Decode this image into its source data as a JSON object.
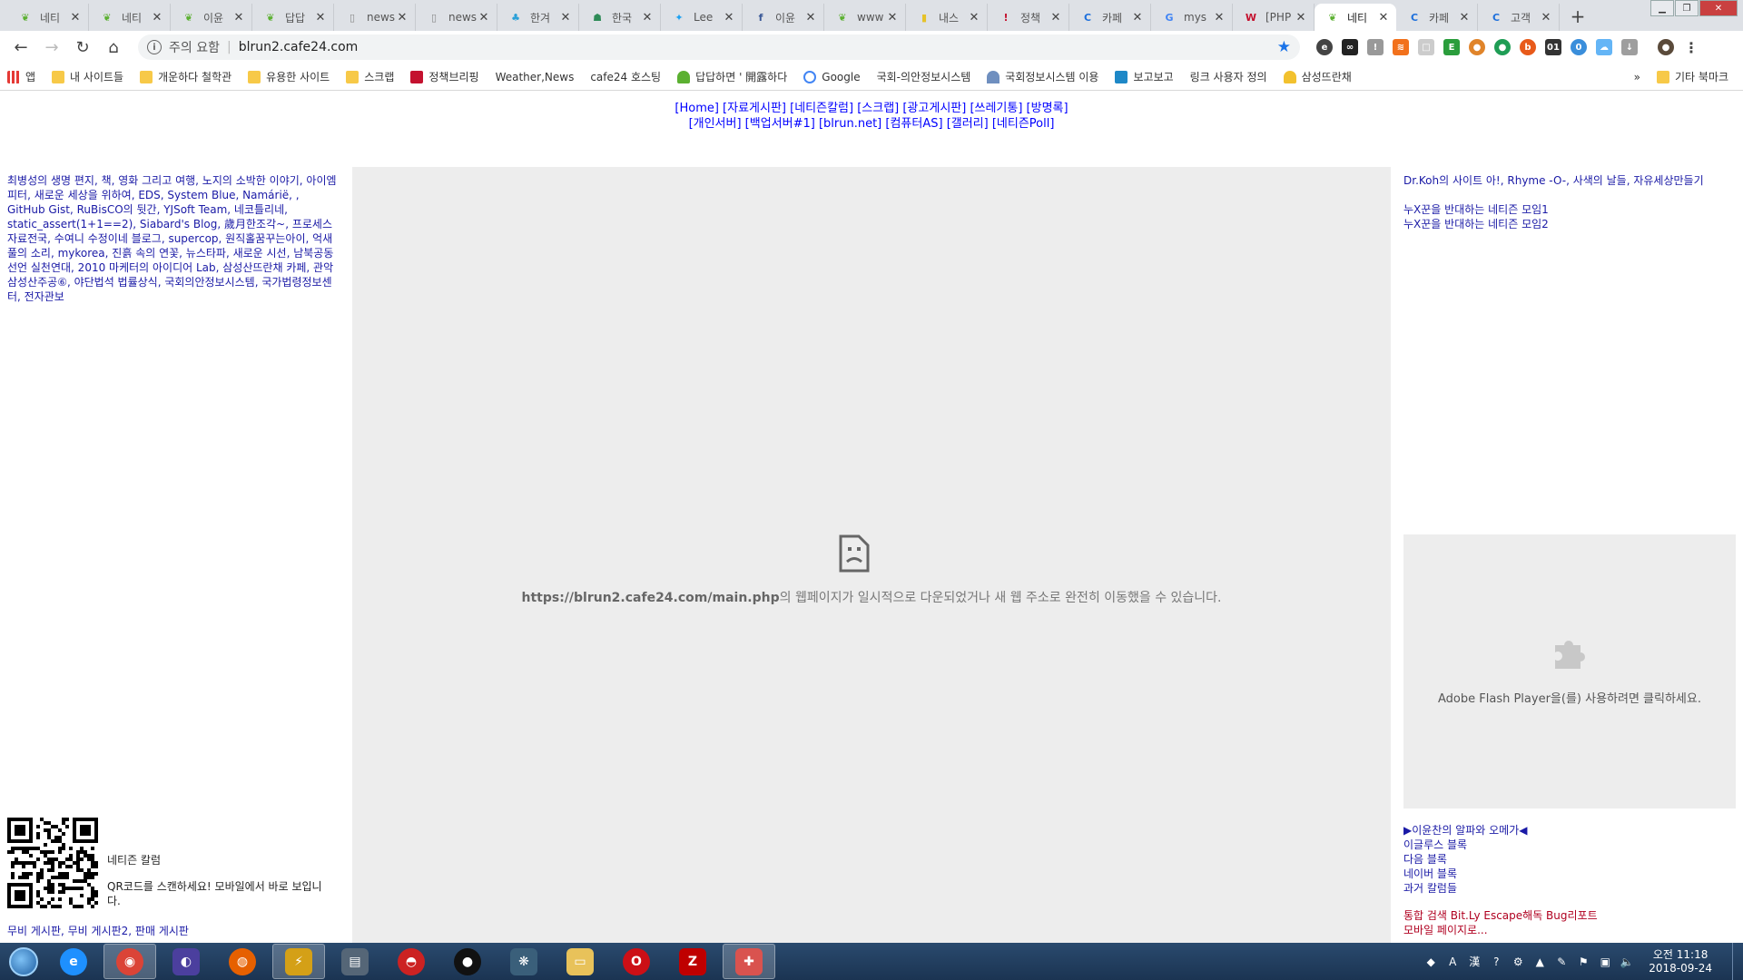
{
  "browser": {
    "tabs": [
      {
        "title": "네티",
        "favicon": "sprout-icon",
        "color": "#5bb031"
      },
      {
        "title": "네티",
        "favicon": "sprout-icon",
        "color": "#5bb031"
      },
      {
        "title": "이윤",
        "favicon": "sprout-icon",
        "color": "#5bb031"
      },
      {
        "title": "답답",
        "favicon": "sprout-icon",
        "color": "#5bb031"
      },
      {
        "title": "news",
        "favicon": "page-icon",
        "color": "#888888"
      },
      {
        "title": "news",
        "favicon": "page-icon",
        "color": "#888888"
      },
      {
        "title": "한겨",
        "favicon": "hani-icon",
        "color": "#2aa0d8"
      },
      {
        "title": "한국",
        "favicon": "person-icon",
        "color": "#2e8b57"
      },
      {
        "title": "Lee",
        "favicon": "twitter-icon",
        "color": "#1da1f2"
      },
      {
        "title": "이윤",
        "favicon": "facebook-icon",
        "color": "#3b5998"
      },
      {
        "title": "www",
        "favicon": "sprout-icon",
        "color": "#5bb031"
      },
      {
        "title": "내스",
        "favicon": "bookmark-icon",
        "color": "#e6c229"
      },
      {
        "title": "정책",
        "favicon": "policy-icon",
        "color": "#c4122f"
      },
      {
        "title": "카페",
        "favicon": "cafe24-icon",
        "color": "#1d6fdc"
      },
      {
        "title": "mys",
        "favicon": "google-icon",
        "color": "#4285f4"
      },
      {
        "title": "[PHP",
        "favicon": "w-icon",
        "color": "#c4122f"
      },
      {
        "title": "네티",
        "favicon": "sprout-icon",
        "color": "#5bb031",
        "active": true
      },
      {
        "title": "카페",
        "favicon": "cafe24-icon",
        "color": "#1d6fdc"
      },
      {
        "title": "고객",
        "favicon": "cafe24-icon",
        "color": "#1d6fdc"
      }
    ],
    "omnibox": {
      "security_label": "주의 요함",
      "url": "blrun2.cafe24.com"
    },
    "bookmarks": [
      {
        "label": "앱",
        "type": "apps"
      },
      {
        "label": "내 사이트들",
        "type": "folder"
      },
      {
        "label": "개운하다 철학관",
        "type": "folder"
      },
      {
        "label": "유용한 사이트",
        "type": "folder"
      },
      {
        "label": "스크랩",
        "type": "folder"
      },
      {
        "label": "정책브리핑",
        "type": "policy"
      },
      {
        "label": "Weather,News",
        "type": "page"
      },
      {
        "label": "cafe24 호스팅",
        "type": "page"
      },
      {
        "label": "답답하면 ' 開露하다",
        "type": "sprout"
      },
      {
        "label": "Google",
        "type": "google"
      },
      {
        "label": "국회-의안정보시스템",
        "type": "page"
      },
      {
        "label": "국회정보시스템 이용",
        "type": "assembly"
      },
      {
        "label": "보고보고",
        "type": "cyan"
      },
      {
        "label": "링크 사용자 정의",
        "type": "page"
      },
      {
        "label": "삼성뜨란채",
        "type": "bell"
      }
    ],
    "bookmarks_overflow": "»",
    "other_bookmarks": "기타 북마크"
  },
  "page": {
    "topnav_line1": "[Home] [자료게시판] [네티즌칼럼] [스크랩] [광고게시판] [쓰레기통] [방명록]",
    "topnav_line2": "[개인서버] [백업서버#1] [blrun.net] [컴퓨터AS] [갤러리] [네티즌Poll]",
    "left_links": "최병성의 생명 편지, 책, 영화 그리고 여행, 노지의 소박한 이야기, 아이엠피터, 새로운 세상을 위하여, EDS, System Blue, Namárië, , GitHub Gist, RuBisCO의 뒷간, YJSoft Team, 네코틀리네, static_assert(1+1==2), Siabard's Blog, 歲月한조각~, 프로세스 자료전국, 수여니 수정이네 블로그, supercop, 원직홀꿈꾸는아이, 억새풀의 소리, mykorea, 진흙 속의 연꽃, 뉴스타파, 새로운 시선, 남북공동선언 실천연대, 2010 마케터의 아이디어 Lab, 삼성산뜨란채 카페, 관악삼성산주공⑥, 야단법석 법률상식, 국회의안정보시스템, 국가법령정보센터, 전자관보",
    "error_url": "https://blrun2.cafe24.com/main.php",
    "error_msg": "의 웹페이지가 일시적으로 다운되었거나 새 웹 주소로 완전히 이동했을 수 있습니다.",
    "right_top_link": "Dr.Koh의 사이트 아!, Rhyme -O-, 사색의 날들, 자유세상만들기",
    "right_oppose_1": "누X꾼을 반대하는 네티즌 모임1",
    "right_oppose_2": "누X꾼을 반대하는 네티즌 모임2",
    "flash_text": "Adobe Flash Player을(를) 사용하려면 클릭하세요.",
    "right_links": [
      "▶이윤찬의 알파와 오메가◀",
      "이글루스 블록",
      "다음 블록",
      "네이버 블록",
      "과거 칼럼들"
    ],
    "red_links": [
      "통합 검색 Bit.Ly Escape해독 Bug리포트",
      "모바일 페이지로..."
    ],
    "qr_title": "네티즌 칼럼",
    "qr_desc": "QR코드를 스캔하세요! 모바일에서 바로 보입니다.",
    "boards": "무비 게시판, 무비 게시판2, 판매 게시판"
  },
  "taskbar": {
    "apps": [
      "ie-icon",
      "chrome-icon",
      "eclipse-icon",
      "firefox-icon",
      "winamp-icon",
      "book-icon",
      "pokeball-icon",
      "record-icon",
      "tree-icon",
      "folder-icon",
      "opera-icon",
      "filezilla-icon",
      "paint-icon"
    ],
    "clock_time": "오전 11:18",
    "clock_date": "2018-09-24"
  }
}
